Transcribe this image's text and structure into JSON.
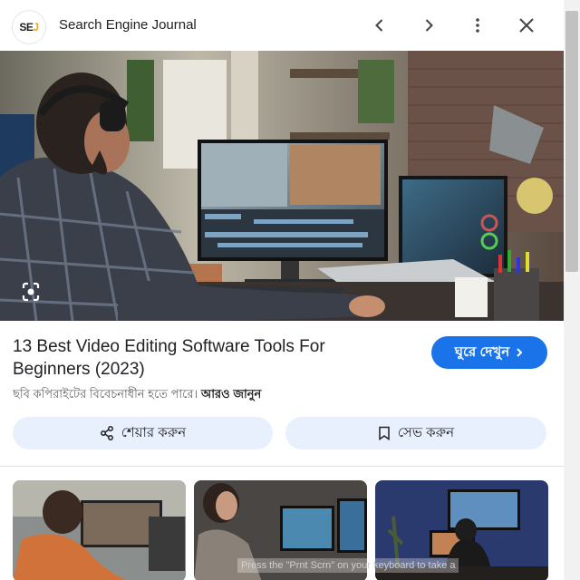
{
  "header": {
    "logo_text_main": "SE",
    "logo_text_accent": "J",
    "site_name": "Search Engine Journal"
  },
  "article": {
    "title": "13 Best Video Editing Software Tools For Beginners (2023)",
    "visit_label": "ঘুরে দেখুন",
    "copyright_text": "ছবি কপিরাইটের বিবেচনাধীন হতে পারে।",
    "learn_more": "আরও জানুন"
  },
  "actions": {
    "share_label": "শেয়ার করুন",
    "save_label": "সেভ করুন"
  },
  "overlay_hint": "Press the \"Prnt Scrn\" on your keyboard to take a",
  "colors": {
    "accent": "#1a73e8",
    "pill_bg": "#e8f0fe"
  }
}
